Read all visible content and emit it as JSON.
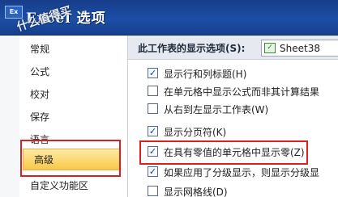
{
  "window": {
    "title": "Excel 选项",
    "watermark": "什么值得买",
    "icon": "excel-app-icon",
    "icon_glyph": "Ex"
  },
  "nav": {
    "items": [
      {
        "label": "常规",
        "selected": false
      },
      {
        "label": "公式",
        "selected": false
      },
      {
        "label": "校对",
        "selected": false
      },
      {
        "label": "保存",
        "selected": false
      },
      {
        "label": "语言",
        "selected": false
      },
      {
        "label": "高级",
        "selected": true
      },
      {
        "label": "自定义功能区",
        "selected": false
      }
    ]
  },
  "options": {
    "section_label": "此工作表的显示选项(S):",
    "sheet_select": {
      "value": "Sheet38",
      "icon": "worksheet-icon",
      "icon_glyph": "✓"
    },
    "items": [
      {
        "label": "显示行和列标题(H)",
        "checked": true
      },
      {
        "label": "在单元格中显示公式而非其计算结果",
        "checked": false
      },
      {
        "label": "从右到左显示工作表(W)",
        "checked": false
      },
      {
        "label": "显示分页符(K)",
        "checked": true
      },
      {
        "label": "在具有零值的单元格中显示零(Z)",
        "checked": true
      },
      {
        "label": "如果应用了分级显示，则显示分级显",
        "checked": true
      },
      {
        "label": "显示网格线(D)",
        "checked": false
      }
    ],
    "check_glyph": "✓"
  },
  "colors": {
    "titlebar": "#1c4fa6",
    "selected_nav": "#fbd66a",
    "annotation_red": "#d92124"
  }
}
